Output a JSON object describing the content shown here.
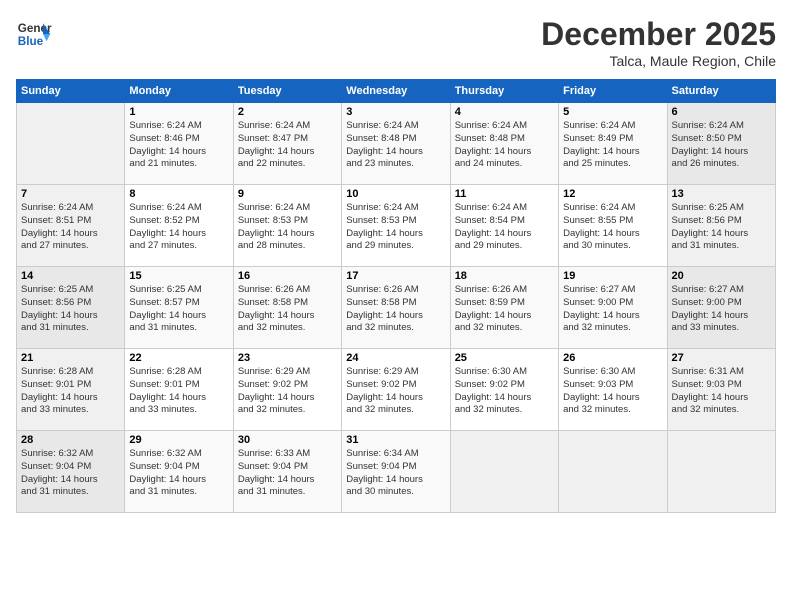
{
  "header": {
    "logo_general": "General",
    "logo_blue": "Blue",
    "title": "December 2025",
    "subtitle": "Talca, Maule Region, Chile"
  },
  "days_of_week": [
    "Sunday",
    "Monday",
    "Tuesday",
    "Wednesday",
    "Thursday",
    "Friday",
    "Saturday"
  ],
  "weeks": [
    [
      {
        "num": "",
        "info": ""
      },
      {
        "num": "1",
        "info": "Sunrise: 6:24 AM\nSunset: 8:46 PM\nDaylight: 14 hours\nand 21 minutes."
      },
      {
        "num": "2",
        "info": "Sunrise: 6:24 AM\nSunset: 8:47 PM\nDaylight: 14 hours\nand 22 minutes."
      },
      {
        "num": "3",
        "info": "Sunrise: 6:24 AM\nSunset: 8:48 PM\nDaylight: 14 hours\nand 23 minutes."
      },
      {
        "num": "4",
        "info": "Sunrise: 6:24 AM\nSunset: 8:48 PM\nDaylight: 14 hours\nand 24 minutes."
      },
      {
        "num": "5",
        "info": "Sunrise: 6:24 AM\nSunset: 8:49 PM\nDaylight: 14 hours\nand 25 minutes."
      },
      {
        "num": "6",
        "info": "Sunrise: 6:24 AM\nSunset: 8:50 PM\nDaylight: 14 hours\nand 26 minutes."
      }
    ],
    [
      {
        "num": "7",
        "info": "Sunrise: 6:24 AM\nSunset: 8:51 PM\nDaylight: 14 hours\nand 27 minutes."
      },
      {
        "num": "8",
        "info": "Sunrise: 6:24 AM\nSunset: 8:52 PM\nDaylight: 14 hours\nand 27 minutes."
      },
      {
        "num": "9",
        "info": "Sunrise: 6:24 AM\nSunset: 8:53 PM\nDaylight: 14 hours\nand 28 minutes."
      },
      {
        "num": "10",
        "info": "Sunrise: 6:24 AM\nSunset: 8:53 PM\nDaylight: 14 hours\nand 29 minutes."
      },
      {
        "num": "11",
        "info": "Sunrise: 6:24 AM\nSunset: 8:54 PM\nDaylight: 14 hours\nand 29 minutes."
      },
      {
        "num": "12",
        "info": "Sunrise: 6:24 AM\nSunset: 8:55 PM\nDaylight: 14 hours\nand 30 minutes."
      },
      {
        "num": "13",
        "info": "Sunrise: 6:25 AM\nSunset: 8:56 PM\nDaylight: 14 hours\nand 31 minutes."
      }
    ],
    [
      {
        "num": "14",
        "info": "Sunrise: 6:25 AM\nSunset: 8:56 PM\nDaylight: 14 hours\nand 31 minutes."
      },
      {
        "num": "15",
        "info": "Sunrise: 6:25 AM\nSunset: 8:57 PM\nDaylight: 14 hours\nand 31 minutes."
      },
      {
        "num": "16",
        "info": "Sunrise: 6:26 AM\nSunset: 8:58 PM\nDaylight: 14 hours\nand 32 minutes."
      },
      {
        "num": "17",
        "info": "Sunrise: 6:26 AM\nSunset: 8:58 PM\nDaylight: 14 hours\nand 32 minutes."
      },
      {
        "num": "18",
        "info": "Sunrise: 6:26 AM\nSunset: 8:59 PM\nDaylight: 14 hours\nand 32 minutes."
      },
      {
        "num": "19",
        "info": "Sunrise: 6:27 AM\nSunset: 9:00 PM\nDaylight: 14 hours\nand 32 minutes."
      },
      {
        "num": "20",
        "info": "Sunrise: 6:27 AM\nSunset: 9:00 PM\nDaylight: 14 hours\nand 33 minutes."
      }
    ],
    [
      {
        "num": "21",
        "info": "Sunrise: 6:28 AM\nSunset: 9:01 PM\nDaylight: 14 hours\nand 33 minutes."
      },
      {
        "num": "22",
        "info": "Sunrise: 6:28 AM\nSunset: 9:01 PM\nDaylight: 14 hours\nand 33 minutes."
      },
      {
        "num": "23",
        "info": "Sunrise: 6:29 AM\nSunset: 9:02 PM\nDaylight: 14 hours\nand 32 minutes."
      },
      {
        "num": "24",
        "info": "Sunrise: 6:29 AM\nSunset: 9:02 PM\nDaylight: 14 hours\nand 32 minutes."
      },
      {
        "num": "25",
        "info": "Sunrise: 6:30 AM\nSunset: 9:02 PM\nDaylight: 14 hours\nand 32 minutes."
      },
      {
        "num": "26",
        "info": "Sunrise: 6:30 AM\nSunset: 9:03 PM\nDaylight: 14 hours\nand 32 minutes."
      },
      {
        "num": "27",
        "info": "Sunrise: 6:31 AM\nSunset: 9:03 PM\nDaylight: 14 hours\nand 32 minutes."
      }
    ],
    [
      {
        "num": "28",
        "info": "Sunrise: 6:32 AM\nSunset: 9:04 PM\nDaylight: 14 hours\nand 31 minutes."
      },
      {
        "num": "29",
        "info": "Sunrise: 6:32 AM\nSunset: 9:04 PM\nDaylight: 14 hours\nand 31 minutes."
      },
      {
        "num": "30",
        "info": "Sunrise: 6:33 AM\nSunset: 9:04 PM\nDaylight: 14 hours\nand 31 minutes."
      },
      {
        "num": "31",
        "info": "Sunrise: 6:34 AM\nSunset: 9:04 PM\nDaylight: 14 hours\nand 30 minutes."
      },
      {
        "num": "",
        "info": ""
      },
      {
        "num": "",
        "info": ""
      },
      {
        "num": "",
        "info": ""
      }
    ]
  ]
}
